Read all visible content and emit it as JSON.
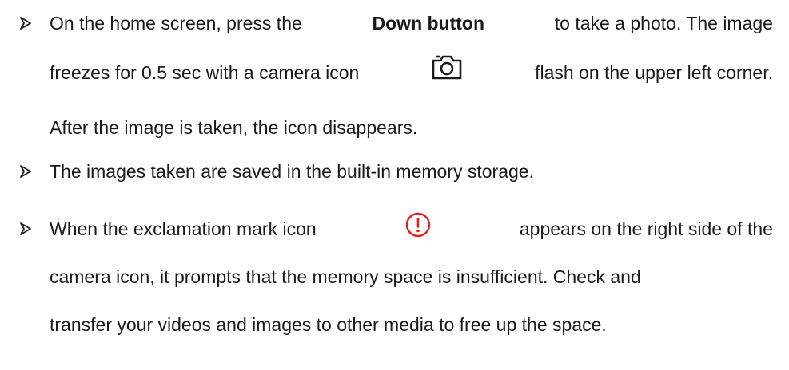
{
  "paragraphs": [
    {
      "lines": [
        {
          "pre": "On the home screen, press the ",
          "bold": "Down button",
          "post": " to take a photo. The image"
        },
        {
          "pre": "freezes for 0.5 sec with a camera icon",
          "icon": "camera-icon",
          "post": "flash on the upper left corner."
        },
        {
          "text": "After the image is taken, the icon disappears."
        }
      ]
    },
    {
      "lines": [
        {
          "text": "The images taken are saved in the built-in memory storage."
        }
      ]
    },
    {
      "lines": [
        {
          "pre": "When the exclamation mark icon",
          "icon": "exclamation-circle-icon",
          "post": "appears on the right side of the"
        },
        {
          "text": "camera icon, it prompts that the memory space is insufficient. Check and"
        },
        {
          "text": "transfer your videos and images to other media to free up the space."
        }
      ]
    }
  ],
  "colors": {
    "text": "#1a1a1a",
    "bullet": "#1a1a1a",
    "exclamation_icon": "#e0201c"
  }
}
